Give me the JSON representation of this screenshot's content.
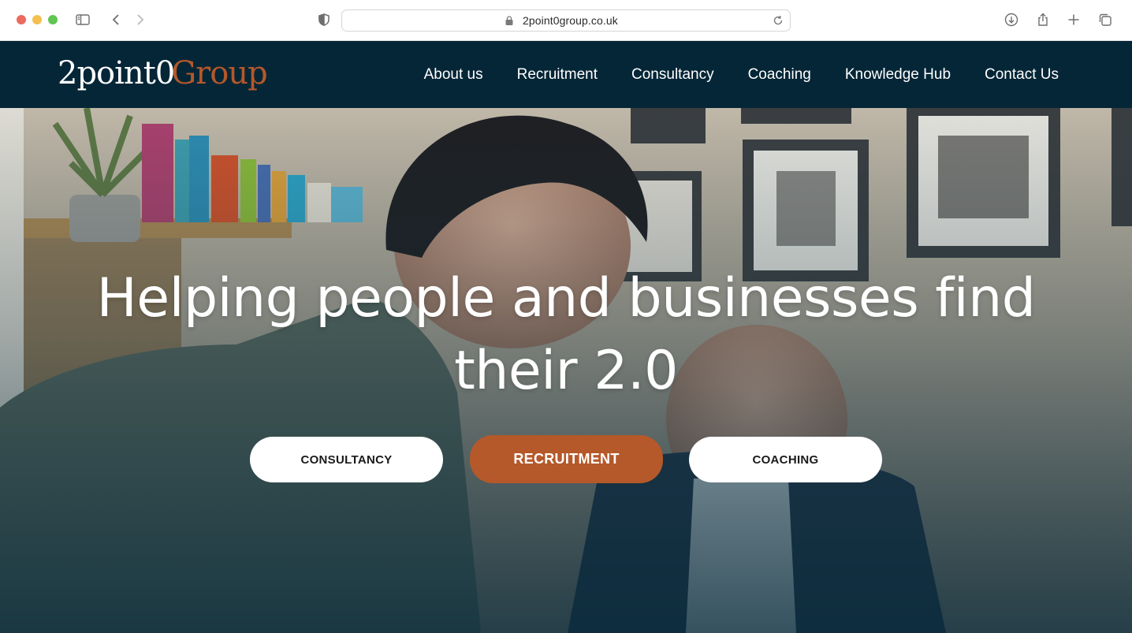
{
  "browser": {
    "url": "2point0group.co.uk"
  },
  "header": {
    "logo_part1": "2point0",
    "logo_part2": "Group",
    "nav": [
      {
        "label": "About us"
      },
      {
        "label": "Recruitment"
      },
      {
        "label": "Consultancy"
      },
      {
        "label": "Coaching"
      },
      {
        "label": "Knowledge Hub"
      },
      {
        "label": "Contact Us"
      }
    ]
  },
  "hero": {
    "headline_line1": "Helping people and businesses find",
    "headline_line2": "their 2.0",
    "buttons": {
      "consultancy": "CONSULTANCY",
      "recruitment": "RECRUITMENT",
      "coaching": "COACHING"
    }
  },
  "colors": {
    "header_bg": "#052637",
    "accent": "#b5582a",
    "button_light": "#ffffff"
  }
}
